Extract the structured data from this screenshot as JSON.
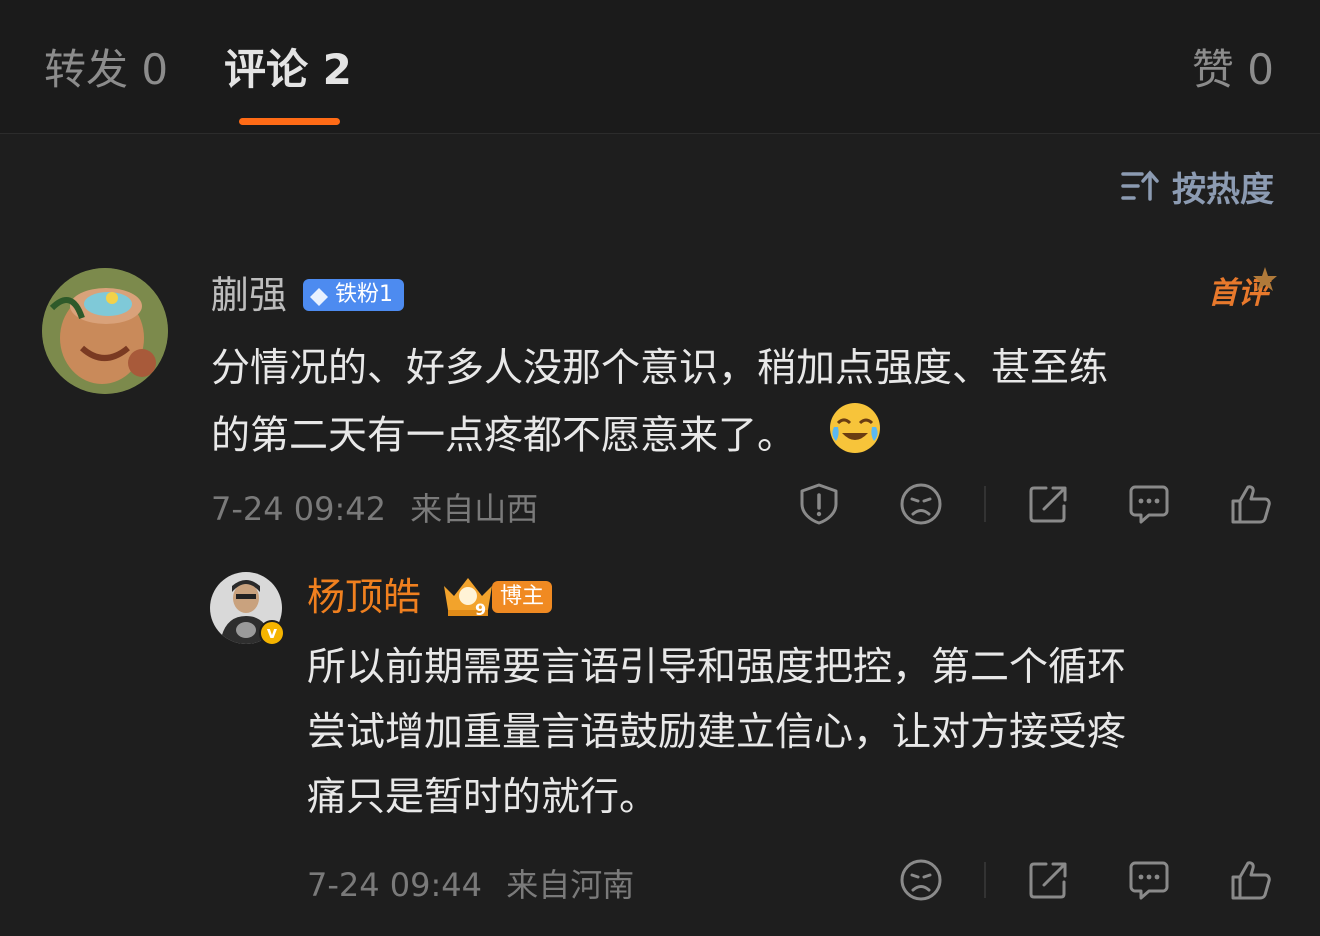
{
  "tabs": [
    {
      "label": "转发",
      "count": "0"
    },
    {
      "label": "评论",
      "count": "2"
    },
    {
      "label": "赞",
      "count": "0"
    }
  ],
  "sort": {
    "label": "按热度"
  },
  "comments": [
    {
      "name": "蒯强",
      "badge": "铁粉1",
      "tag": "首评",
      "text_line1": "分情况的、好多人没那个意识，稍加点强度、甚至练",
      "text_line2": "的第二天有一点疼都不愿意来了。",
      "emoji": "laughing-crying-emoji",
      "time": "7-24 09:42",
      "location": "来自山西"
    },
    {
      "name": "杨顶皓",
      "badge": "博主",
      "crown_level": "9",
      "verified": "v",
      "text_lines": [
        "所以前期需要言语引导和强度把控，第二个循环",
        "尝试增加重量言语鼓励建立信心，让对方接受疼",
        "痛只是暂时的就行。"
      ],
      "time": "7-24 09:44",
      "location": "来自河南"
    }
  ],
  "colors": {
    "background": "#1e1e1e",
    "accent": "#ff6b16",
    "blogger_name": "#f0801f",
    "fan_badge": "#4d8bf0",
    "meta": "#7a7a7a"
  }
}
